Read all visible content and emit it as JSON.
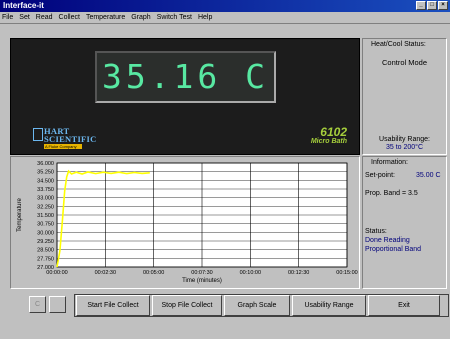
{
  "window": {
    "title": "Interface-it",
    "controls": [
      "_",
      "□",
      "×"
    ]
  },
  "menu": [
    "File",
    "Set",
    "Read",
    "Collect",
    "Temperature",
    "Graph",
    "Switch Test",
    "Help"
  ],
  "display": {
    "reading": "35.16 C",
    "brand_line1": "HART",
    "brand_line2": "SCIENTIFIC",
    "brand_tagline": "A Fluke Company",
    "model_number": "6102",
    "model_name": "Micro Bath"
  },
  "heat_cool": {
    "caption": "Heat/Cool Status:",
    "mode": "Control Mode",
    "usability_label": "Usability Range:",
    "usability_value": "35 to 200°C"
  },
  "information": {
    "caption": "Information:",
    "setpoint_label": "Set-point:",
    "setpoint_value": "35.00 C",
    "prop_band": "Prop. Band = 3.5",
    "status_label": "Status:",
    "status_lines": [
      "Done Reading",
      "Proportional Band"
    ]
  },
  "chart_data": {
    "type": "line",
    "ylabel": "Temperature",
    "xlabel": "Time (minutes)",
    "y_ticks": [
      "36.000",
      "35.250",
      "34.500",
      "33.750",
      "33.000",
      "32.250",
      "31.500",
      "30.750",
      "30.000",
      "29.250",
      "28.500",
      "27.750",
      "27.000"
    ],
    "x_ticks": [
      "00:00:00",
      "00:02:30",
      "00:05:00",
      "00:07:30",
      "00:10:00",
      "00:12:30",
      "00:15:00"
    ],
    "ylim": [
      27.0,
      36.0
    ],
    "xlim_minutes": [
      0,
      15
    ],
    "grid": true,
    "series": [
      {
        "color": "#ffff00",
        "points": [
          [
            0.0,
            27.0
          ],
          [
            0.15,
            28.4
          ],
          [
            0.28,
            31.0
          ],
          [
            0.4,
            33.6
          ],
          [
            0.5,
            34.8
          ],
          [
            0.6,
            35.3
          ],
          [
            0.75,
            35.05
          ],
          [
            1.0,
            35.2
          ],
          [
            1.3,
            35.05
          ],
          [
            1.6,
            35.22
          ],
          [
            2.0,
            35.08
          ],
          [
            2.4,
            35.2
          ],
          [
            2.8,
            35.1
          ],
          [
            3.2,
            35.2
          ],
          [
            3.6,
            35.08
          ],
          [
            4.0,
            35.18
          ],
          [
            4.4,
            35.1
          ],
          [
            4.8,
            35.15
          ]
        ]
      }
    ]
  },
  "buttons": {
    "small_left": "C",
    "small_right": "",
    "start_file_collect": "Start File Collect",
    "stop_file_collect": "Stop File Collect",
    "graph_scale": "Graph Scale",
    "usability_range": "Usability Range",
    "exit": "Exit"
  }
}
